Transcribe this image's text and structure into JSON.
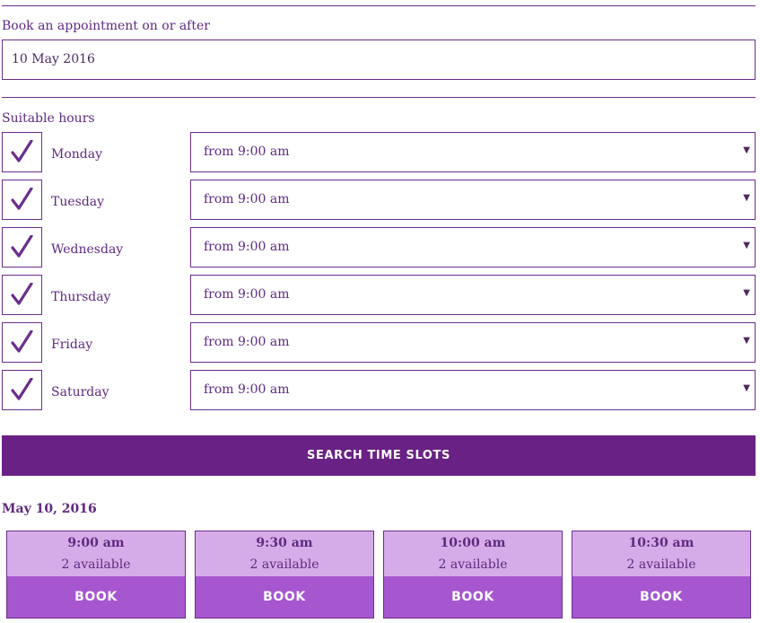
{
  "date_section": {
    "label": "Book an appointment on or after",
    "value": "10 May 2016"
  },
  "hours_section": {
    "label": "Suitable hours",
    "days": [
      {
        "day": "Monday",
        "checked": true,
        "from": "from 9:00 am"
      },
      {
        "day": "Tuesday",
        "checked": true,
        "from": "from 9:00 am"
      },
      {
        "day": "Wednesday",
        "checked": true,
        "from": "from 9:00 am"
      },
      {
        "day": "Thursday",
        "checked": true,
        "from": "from 9:00 am"
      },
      {
        "day": "Friday",
        "checked": true,
        "from": "from 9:00 am"
      },
      {
        "day": "Saturday",
        "checked": true,
        "from": "from 9:00 am"
      }
    ],
    "dropdown_icon": "caret-down-icon"
  },
  "search_button": {
    "label": "SEARCH TIME SLOTS"
  },
  "results": {
    "date_heading": "May 10, 2016",
    "slots": [
      {
        "time": "9:00 am",
        "available": "2 available",
        "book_label": "BOOK"
      },
      {
        "time": "9:30 am",
        "available": "2 available",
        "book_label": "BOOK"
      },
      {
        "time": "10:00 am",
        "available": "2 available",
        "book_label": "BOOK"
      },
      {
        "time": "10:30 am",
        "available": "2 available",
        "book_label": "BOOK"
      }
    ]
  },
  "colors": {
    "accent": "#6a2185",
    "slot_bg": "#d6ace8",
    "book_bg": "#a656cf",
    "border": "#6b2f8a"
  }
}
